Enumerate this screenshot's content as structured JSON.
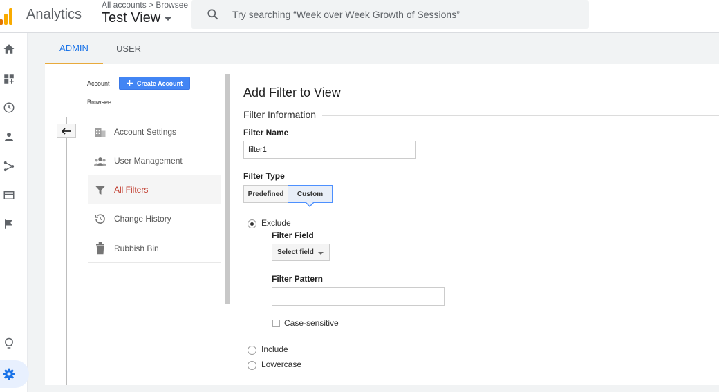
{
  "header": {
    "app_name": "Analytics",
    "breadcrumb": "All accounts > Browsee",
    "view_name": "Test View",
    "search_placeholder": "Try searching “Week over Week Growth of Sessions”"
  },
  "tabs": [
    {
      "label": "ADMIN",
      "active": true
    },
    {
      "label": "USER",
      "active": false
    }
  ],
  "account": {
    "label": "Account",
    "create_button": "Create Account",
    "name": "Browsee"
  },
  "menu": [
    {
      "label": "Account Settings",
      "icon": "building-icon"
    },
    {
      "label": "User Management",
      "icon": "people-icon"
    },
    {
      "label": "All Filters",
      "icon": "filter-icon",
      "active": true
    },
    {
      "label": "Change History",
      "icon": "history-icon"
    },
    {
      "label": "Rubbish Bin",
      "icon": "trash-icon"
    }
  ],
  "form": {
    "title": "Add Filter to View",
    "section": "Filter Information",
    "filter_name_label": "Filter Name",
    "filter_name_value": "filter1",
    "filter_type_label": "Filter Type",
    "type_options": [
      "Predefined",
      "Custom"
    ],
    "selected_type": "Custom",
    "radio_exclude": "Exclude",
    "filter_field_label": "Filter Field",
    "select_field": "Select field",
    "filter_pattern_label": "Filter Pattern",
    "filter_pattern_value": "",
    "case_sensitive": "Case-sensitive",
    "radio_include": "Include",
    "radio_lowercase": "Lowercase"
  },
  "colors": {
    "accent": "#1a73e8",
    "create_button": "#4285f4",
    "active_menu": "#c0392b",
    "tab_underline": "#e8aa3c"
  }
}
